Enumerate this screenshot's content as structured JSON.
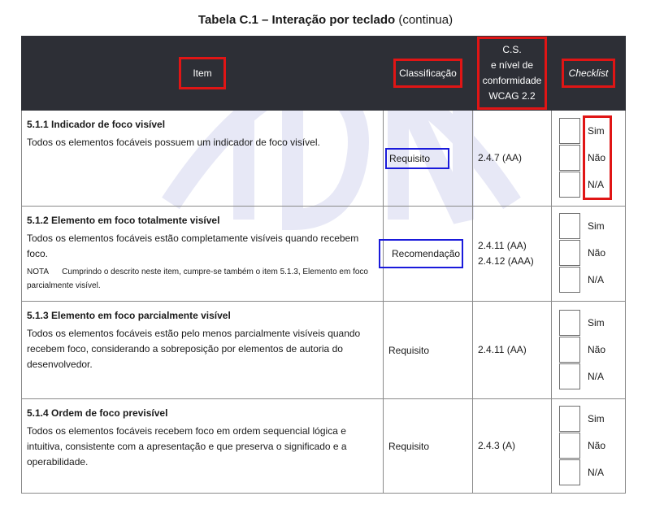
{
  "title": {
    "bold": "Tabela C.1 – Interação por teclado",
    "suffix": "(continua)"
  },
  "headers": {
    "item": "Item",
    "classificacao": "Classificação",
    "cs_lines": [
      "C.S.",
      "e nível de",
      "conformidade",
      "WCAG 2.2"
    ],
    "checklist": "Checklist"
  },
  "rows": [
    {
      "title": "5.1.1 Indicador de foco visível",
      "description": "Todos os elementos focáveis possuem um indicador de foco visível.",
      "classification": "Requisito",
      "wcag": [
        "2.4.7 (AA)"
      ],
      "options": [
        "Sim",
        "Não",
        "N/A"
      ]
    },
    {
      "title": "5.1.2 Elemento em foco totalmente visível",
      "description": "Todos os elementos focáveis estão completamente visíveis quando recebem foco.",
      "note": "NOTA      Cumprindo o descrito neste item, cumpre-se também o item 5.1.3, Elemento em foco parcialmente visível.",
      "classification": "Recomendação",
      "wcag": [
        "2.4.11 (AA)",
        "2.4.12 (AAA)"
      ],
      "options": [
        "Sim",
        "Não",
        "N/A"
      ]
    },
    {
      "title": "5.1.3 Elemento em foco parcialmente visível",
      "description": "Todos os elementos focáveis estão pelo menos parcialmente visíveis quando recebem foco, considerando a sobreposição por elementos de autoria do desenvolvedor.",
      "classification": "Requisito",
      "wcag": [
        "2.4.11 (AA)"
      ],
      "options": [
        "Sim",
        "Não",
        "N/A"
      ]
    },
    {
      "title": "5.1.4 Ordem de foco previsível",
      "description": "Todos os elementos focáveis recebem foco em ordem sequencial lógica e intuitiva, consistente com a apresentação e que preserva o significado e a operabilidade.",
      "classification": "Requisito",
      "wcag": [
        "2.4.3 (A)"
      ],
      "options": [
        "Sim",
        "Não",
        "N/A"
      ]
    }
  ],
  "colors": {
    "header_bg": "#2d2f36",
    "highlight_red": "#e01515",
    "highlight_blue": "#1a1adb"
  }
}
